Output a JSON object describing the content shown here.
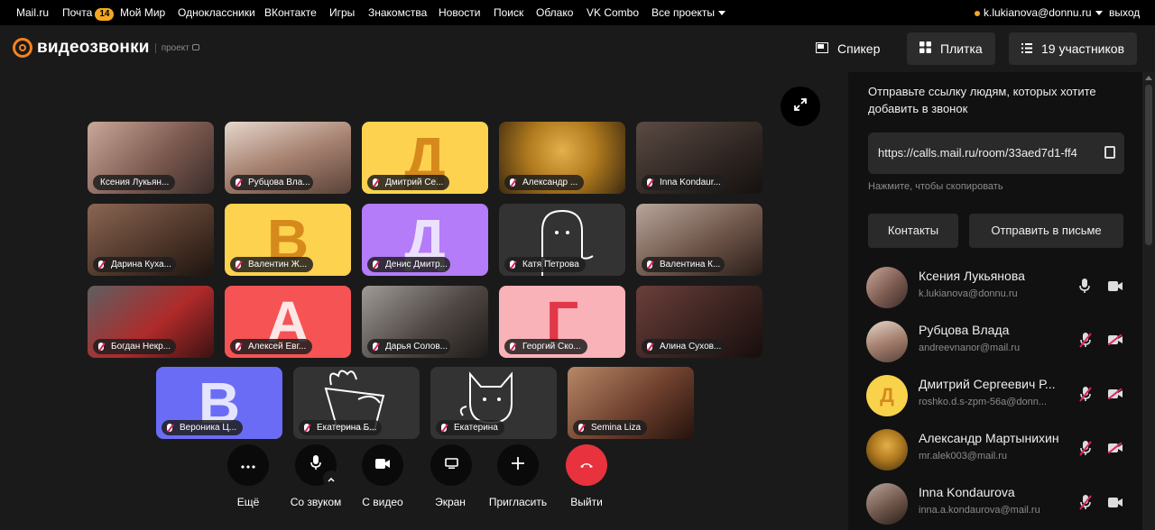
{
  "portal": {
    "links": [
      "Mail.ru",
      "Почта",
      "Мой Мир",
      "Одноклассники",
      "ВКонтакте",
      "Игры",
      "Знакомства",
      "Новости",
      "Поиск",
      "Облако",
      "VK Combo",
      "Все проекты"
    ],
    "mail_badge": "14",
    "user_email": "k.lukianova@donnu.ru",
    "logout": "выход"
  },
  "header": {
    "brand": "видеозвонки",
    "brand_sub": "проект",
    "speaker_label": "Спикер",
    "tile_label": "Плитка",
    "participants_label": "19 участников"
  },
  "tiles": [
    {
      "name": "Ксения Лукьян...",
      "letter": "",
      "mic": "none"
    },
    {
      "name": "Рубцова Вла...",
      "letter": "",
      "mic": "muted"
    },
    {
      "name": "Дмитрий Се...",
      "letter": "Д",
      "mic": "muted"
    },
    {
      "name": "Александр ...",
      "letter": "",
      "mic": "muted"
    },
    {
      "name": "Inna Kondaur...",
      "letter": "",
      "mic": "muted"
    },
    {
      "name": "Дарина Куха...",
      "letter": "",
      "mic": "muted"
    },
    {
      "name": "Валентин Ж...",
      "letter": "В",
      "mic": "muted"
    },
    {
      "name": "Денис Дмитр...",
      "letter": "Д",
      "mic": "muted"
    },
    {
      "name": "Катя Петрова",
      "letter": "",
      "mic": "muted"
    },
    {
      "name": "Валентина К...",
      "letter": "",
      "mic": "muted"
    },
    {
      "name": "Богдан Некр...",
      "letter": "",
      "mic": "muted"
    },
    {
      "name": "Алексей Евг...",
      "letter": "А",
      "mic": "muted"
    },
    {
      "name": "Дарья Солов...",
      "letter": "",
      "mic": "muted"
    },
    {
      "name": "Георгий Ско...",
      "letter": "Г",
      "mic": "muted"
    },
    {
      "name": "Алина Сухов...",
      "letter": "",
      "mic": "muted"
    },
    {
      "name": "Вероника Ц...",
      "letter": "В",
      "mic": "muted"
    },
    {
      "name": "Екатерина Б...",
      "letter": "",
      "mic": "muted"
    },
    {
      "name": "Екатерина",
      "letter": "",
      "mic": "muted"
    },
    {
      "name": "Semina Liza",
      "letter": "",
      "mic": "muted"
    }
  ],
  "tile_colors": {
    "yellow": "#fdd24f",
    "yellow_letter": "#d68a1c",
    "purple": "#b47cf8",
    "purple_letter": "#ece0ff",
    "coral": "#f65354",
    "coral_letter": "#ffe6e6",
    "pink": "#f9b2b7",
    "pink_letter": "#e13748",
    "blue": "#6b6cf6",
    "blue_letter": "#e4e4ff"
  },
  "controls": {
    "more": "Ещё",
    "mic": "Со звуком",
    "video": "С видео",
    "screen": "Экран",
    "invite": "Пригласить",
    "leave": "Выйти"
  },
  "panel": {
    "title": "Отправьте ссылку людям, которых хотите добавить в звонок",
    "link": "https://calls.mail.ru/room/33aed7d1-ff4",
    "hint": "Нажмите, чтобы скопировать",
    "contacts_button": "Контакты",
    "email_button": "Отправить в письме",
    "participants": [
      {
        "name": "Ксения Лукьянова",
        "email": "k.lukianova@donnu.ru",
        "avatar_letter": "",
        "mic_muted": false,
        "cam_off": false
      },
      {
        "name": "Рубцова Влада",
        "email": "andreevnanor@mail.ru",
        "avatar_letter": "",
        "mic_muted": true,
        "cam_off": true
      },
      {
        "name": "Дмитрий Сергеевич Р...",
        "email": "roshko.d.s-zpm-56a@donn...",
        "avatar_letter": "Д",
        "mic_muted": true,
        "cam_off": true
      },
      {
        "name": "Александр Мартынихин",
        "email": "mr.alek003@mail.ru",
        "avatar_letter": "",
        "mic_muted": true,
        "cam_off": true
      },
      {
        "name": "Inna Kondaurova",
        "email": "inna.a.kondaurova@mail.ru",
        "avatar_letter": "",
        "mic_muted": true,
        "cam_off": false
      }
    ]
  }
}
